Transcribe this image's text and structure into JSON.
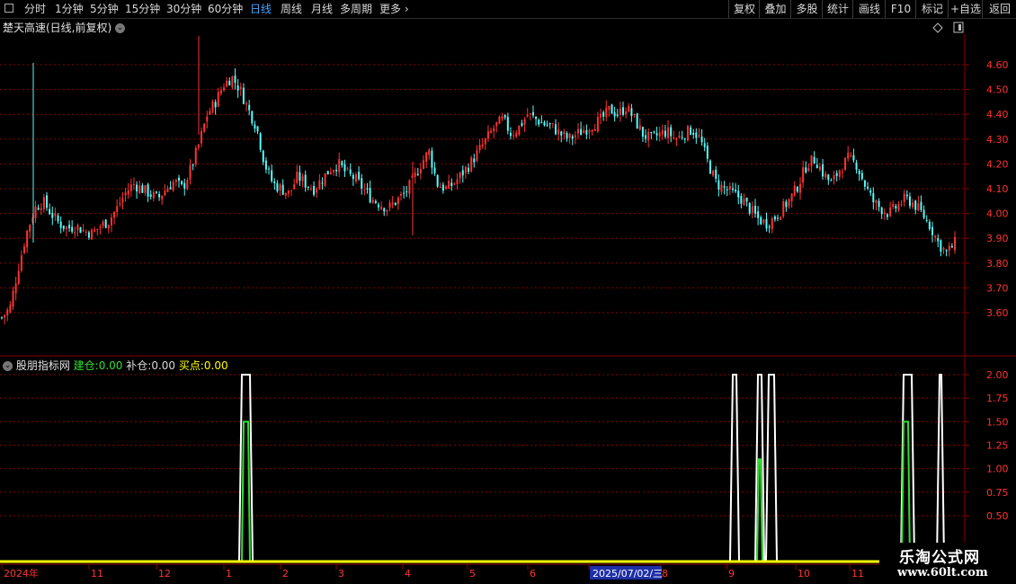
{
  "toolbar": {
    "periods": [
      "分时",
      "1分钟",
      "5分钟",
      "15分钟",
      "30分钟",
      "60分钟",
      "日线",
      "周线",
      "月线",
      "多周期",
      "更多"
    ],
    "active_period": "日线",
    "right_buttons": [
      "复权",
      "叠加",
      "多股",
      "统计",
      "画线",
      "F10",
      "标记",
      "+自选",
      "返回"
    ]
  },
  "main_panel": {
    "title": "楚天高速(日线,前复权)",
    "price_axis_ticks": [
      "4.60",
      "4.50",
      "4.40",
      "4.30",
      "4.20",
      "4.10",
      "4.00",
      "3.90",
      "3.80",
      "3.70",
      "3.60"
    ]
  },
  "indicator_panel": {
    "name": "股朋指标网",
    "items": [
      {
        "label": "建仓:",
        "value": "0.00",
        "color": "#33dd33"
      },
      {
        "label": "补仓:",
        "value": "0.00",
        "color": "#d8d8d8"
      },
      {
        "label": "买点:",
        "value": "0.00",
        "color": "#ffff00"
      }
    ],
    "axis_ticks": [
      "2.00",
      "1.75",
      "1.50",
      "1.25",
      "1.00",
      "0.75",
      "0.50"
    ]
  },
  "time_axis": {
    "labels": [
      "2024年",
      "11",
      "12",
      "1",
      "2",
      "3",
      "4",
      "5",
      "6",
      "7",
      "8",
      "9",
      "10",
      "11"
    ],
    "cursor_label": "2025/07/02/三"
  },
  "watermark": {
    "line1": "乐淘公式网",
    "line2": "www.60lt.com"
  },
  "colors": {
    "up": "#ff3232",
    "down": "#54fcfc",
    "grid": "#8b0000",
    "active": "#4aa3ff",
    "yellow": "#ffff00",
    "green": "#33dd33"
  },
  "chart_data": [
    {
      "type": "candlestick",
      "title": "楚天高速(日线,前复权)",
      "y_range": [
        3.5,
        4.7
      ],
      "y_ticks": [
        3.6,
        3.7,
        3.8,
        3.9,
        4.0,
        4.1,
        4.2,
        4.3,
        4.4,
        4.5,
        4.6
      ],
      "x_labels": [
        "2024年",
        "11",
        "12",
        "1",
        "2",
        "3",
        "4",
        "5",
        "6",
        "7",
        "8",
        "9",
        "10",
        "11"
      ],
      "close_trace": [
        3.58,
        3.62,
        3.78,
        3.92,
        4.02,
        4.05,
        4.0,
        3.96,
        3.94,
        3.95,
        3.93,
        3.92,
        3.95,
        3.97,
        4.02,
        4.08,
        4.12,
        4.1,
        4.08,
        4.06,
        4.1,
        4.13,
        4.1,
        4.18,
        4.28,
        4.4,
        4.45,
        4.52,
        4.55,
        4.5,
        4.42,
        4.35,
        4.2,
        4.12,
        4.1,
        4.08,
        4.15,
        4.12,
        4.1,
        4.14,
        4.18,
        4.2,
        4.16,
        4.14,
        4.1,
        4.06,
        4.04,
        4.02,
        4.05,
        4.08,
        4.13,
        4.2,
        4.25,
        4.12,
        4.1,
        4.12,
        4.16,
        4.2,
        4.25,
        4.3,
        4.35,
        4.38,
        4.32,
        4.35,
        4.4,
        4.38,
        4.36,
        4.35,
        4.32,
        4.3,
        4.32,
        4.34,
        4.36,
        4.38,
        4.42,
        4.4,
        4.43,
        4.38,
        4.32,
        4.3,
        4.32,
        4.33,
        4.3,
        4.32,
        4.34,
        4.3,
        4.2,
        4.12,
        4.1,
        4.08,
        4.06,
        4.02,
        3.98,
        3.96,
        3.98,
        4.02,
        4.06,
        4.12,
        4.2,
        4.22,
        4.16,
        4.12,
        4.18,
        4.22,
        4.2,
        4.12,
        4.05,
        4.02,
        4.0,
        4.03,
        4.06,
        4.04,
        4.0,
        3.95,
        3.88,
        3.84,
        3.88
      ]
    },
    {
      "type": "line",
      "title": "股朋指标网",
      "y_range": [
        0.25,
        2.1
      ],
      "series": [
        {
          "name": "建仓",
          "color": "#33dd33",
          "value": 0.0
        },
        {
          "name": "补仓",
          "color": "#d8d8d8",
          "value": 0.0
        },
        {
          "name": "买点",
          "color": "#ffff00",
          "value": 0.0
        }
      ]
    }
  ]
}
